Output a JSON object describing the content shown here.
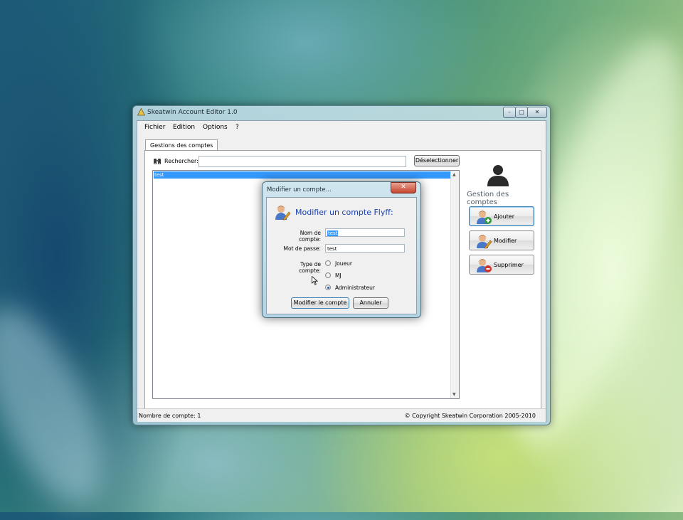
{
  "window": {
    "title": "Skeatwin Account Editor 1.0",
    "caption_buttons": {
      "minimize": "–",
      "maximize": "□",
      "close": "✕"
    }
  },
  "menu": [
    "Fichier",
    "Edition",
    "Options",
    "?"
  ],
  "tab": {
    "label": "Gestions des comptes"
  },
  "search": {
    "label": "Rechercher:",
    "value": "",
    "deselect_button": "Déselectionner"
  },
  "accounts": {
    "items": [
      "test"
    ]
  },
  "side_panel": {
    "heading": "Gestion des comptes",
    "buttons": [
      {
        "label": "Ajouter",
        "icon": "user-add-icon"
      },
      {
        "label": "Modifier",
        "icon": "user-edit-icon"
      },
      {
        "label": "Supprimer",
        "icon": "user-remove-icon"
      }
    ]
  },
  "status": {
    "left": "Nombre de compte: 1",
    "right": "© Copyright Skeatwin Corporation 2005-2010"
  },
  "dialog": {
    "title": "Modifier un compte...",
    "close": "✕",
    "heading": "Modifier un compte Flyff:",
    "fields": {
      "account_name": {
        "label": "Nom de compte:",
        "value": "test"
      },
      "password": {
        "label": "Mot de passe:",
        "value": "test"
      }
    },
    "type": {
      "label": "Type de compte:",
      "options": [
        "Joueur",
        "MJ",
        "Administrateur"
      ],
      "selected": "Administrateur"
    },
    "confirm_button": "Modifier le compte",
    "cancel_button": "Annuler"
  }
}
